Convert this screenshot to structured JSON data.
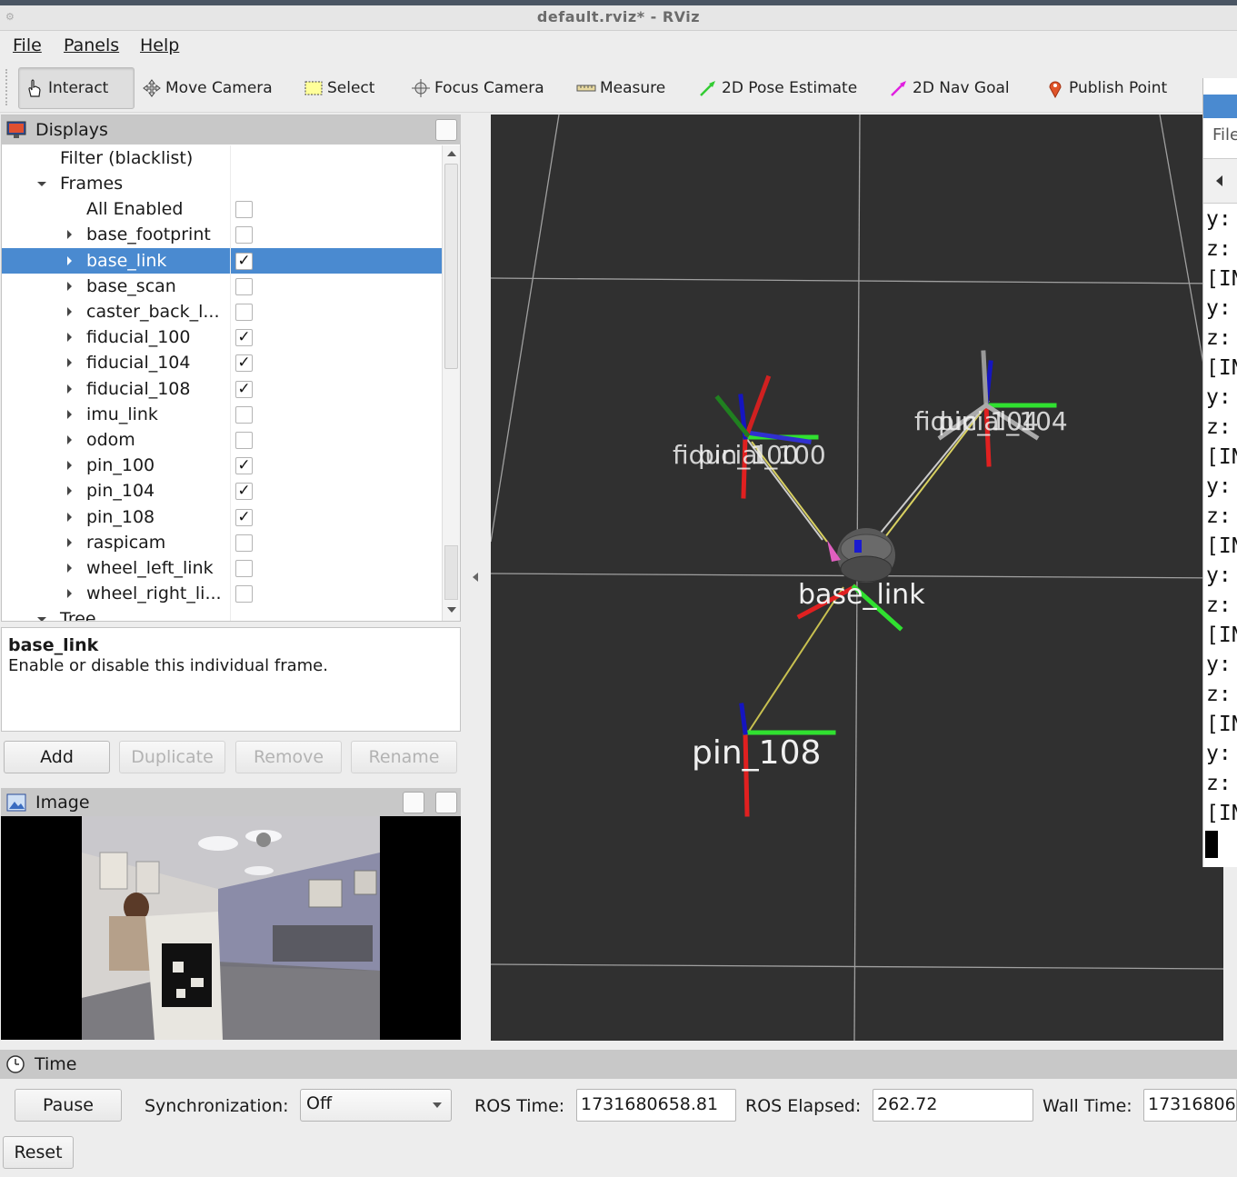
{
  "window": {
    "title": "default.rviz* - RViz"
  },
  "menu": {
    "file": "File",
    "panels": "Panels",
    "help": "Help"
  },
  "toolbar": {
    "interact": "Interact",
    "move_camera": "Move Camera",
    "select": "Select",
    "focus_camera": "Focus Camera",
    "measure": "Measure",
    "pose_estimate": "2D Pose Estimate",
    "nav_goal": "2D Nav Goal",
    "publish_point": "Publish Point"
  },
  "displays": {
    "title": "Displays",
    "rows": [
      {
        "label": "Filter (blacklist)"
      },
      {
        "label": "Frames"
      },
      {
        "label": "All Enabled",
        "checked": ""
      },
      {
        "label": "base_footprint",
        "checked": ""
      },
      {
        "label": "base_link",
        "checked": "✓"
      },
      {
        "label": "base_scan",
        "checked": ""
      },
      {
        "label": "caster_back_l...",
        "checked": ""
      },
      {
        "label": "fiducial_100",
        "checked": "✓"
      },
      {
        "label": "fiducial_104",
        "checked": "✓"
      },
      {
        "label": "fiducial_108",
        "checked": "✓"
      },
      {
        "label": "imu_link",
        "checked": ""
      },
      {
        "label": "odom",
        "checked": ""
      },
      {
        "label": "pin_100",
        "checked": "✓"
      },
      {
        "label": "pin_104",
        "checked": "✓"
      },
      {
        "label": "pin_108",
        "checked": "✓"
      },
      {
        "label": "raspicam",
        "checked": ""
      },
      {
        "label": "wheel_left_link",
        "checked": ""
      },
      {
        "label": "wheel_right_li...",
        "checked": ""
      },
      {
        "label": "Tree"
      }
    ],
    "description_title": "base_link",
    "description_text": "Enable or disable this individual frame.",
    "buttons": {
      "add": "Add",
      "duplicate": "Duplicate",
      "remove": "Remove",
      "rename": "Rename"
    }
  },
  "image_panel": {
    "title": "Image"
  },
  "view3d": {
    "labels": {
      "fiducial_100": "fiducial_100",
      "pin_100": "pin_100",
      "fiducial_104": "fiducial_104",
      "pin_104": "pin_104",
      "base_link": "base_link",
      "pin_108": "pin_108"
    },
    "colors": {
      "background": "#303030",
      "grid": "#a0a0a0",
      "x_axis": "#e02020",
      "y_axis": "#30e030",
      "z_axis": "#1020d0"
    }
  },
  "right_panel": {
    "file_label": "File",
    "terminal_lines": [
      "y:",
      "z:",
      "[IN",
      "y:",
      "z:",
      "[IN",
      "y:",
      "z:",
      "[IN",
      "y:",
      "z:",
      "[IN",
      "y:",
      "z:",
      "[IN",
      "y:",
      "z:",
      "[IN",
      "y:",
      "z:",
      "[IN"
    ]
  },
  "time": {
    "title": "Time",
    "pause": "Pause",
    "sync_label": "Synchronization:",
    "sync_value": "Off",
    "ros_time_label": "ROS Time:",
    "ros_time": "1731680658.81",
    "ros_elapsed_label": "ROS Elapsed:",
    "ros_elapsed": "262.72",
    "wall_time_label": "Wall Time:",
    "wall_time": "17316806",
    "reset": "Reset"
  }
}
